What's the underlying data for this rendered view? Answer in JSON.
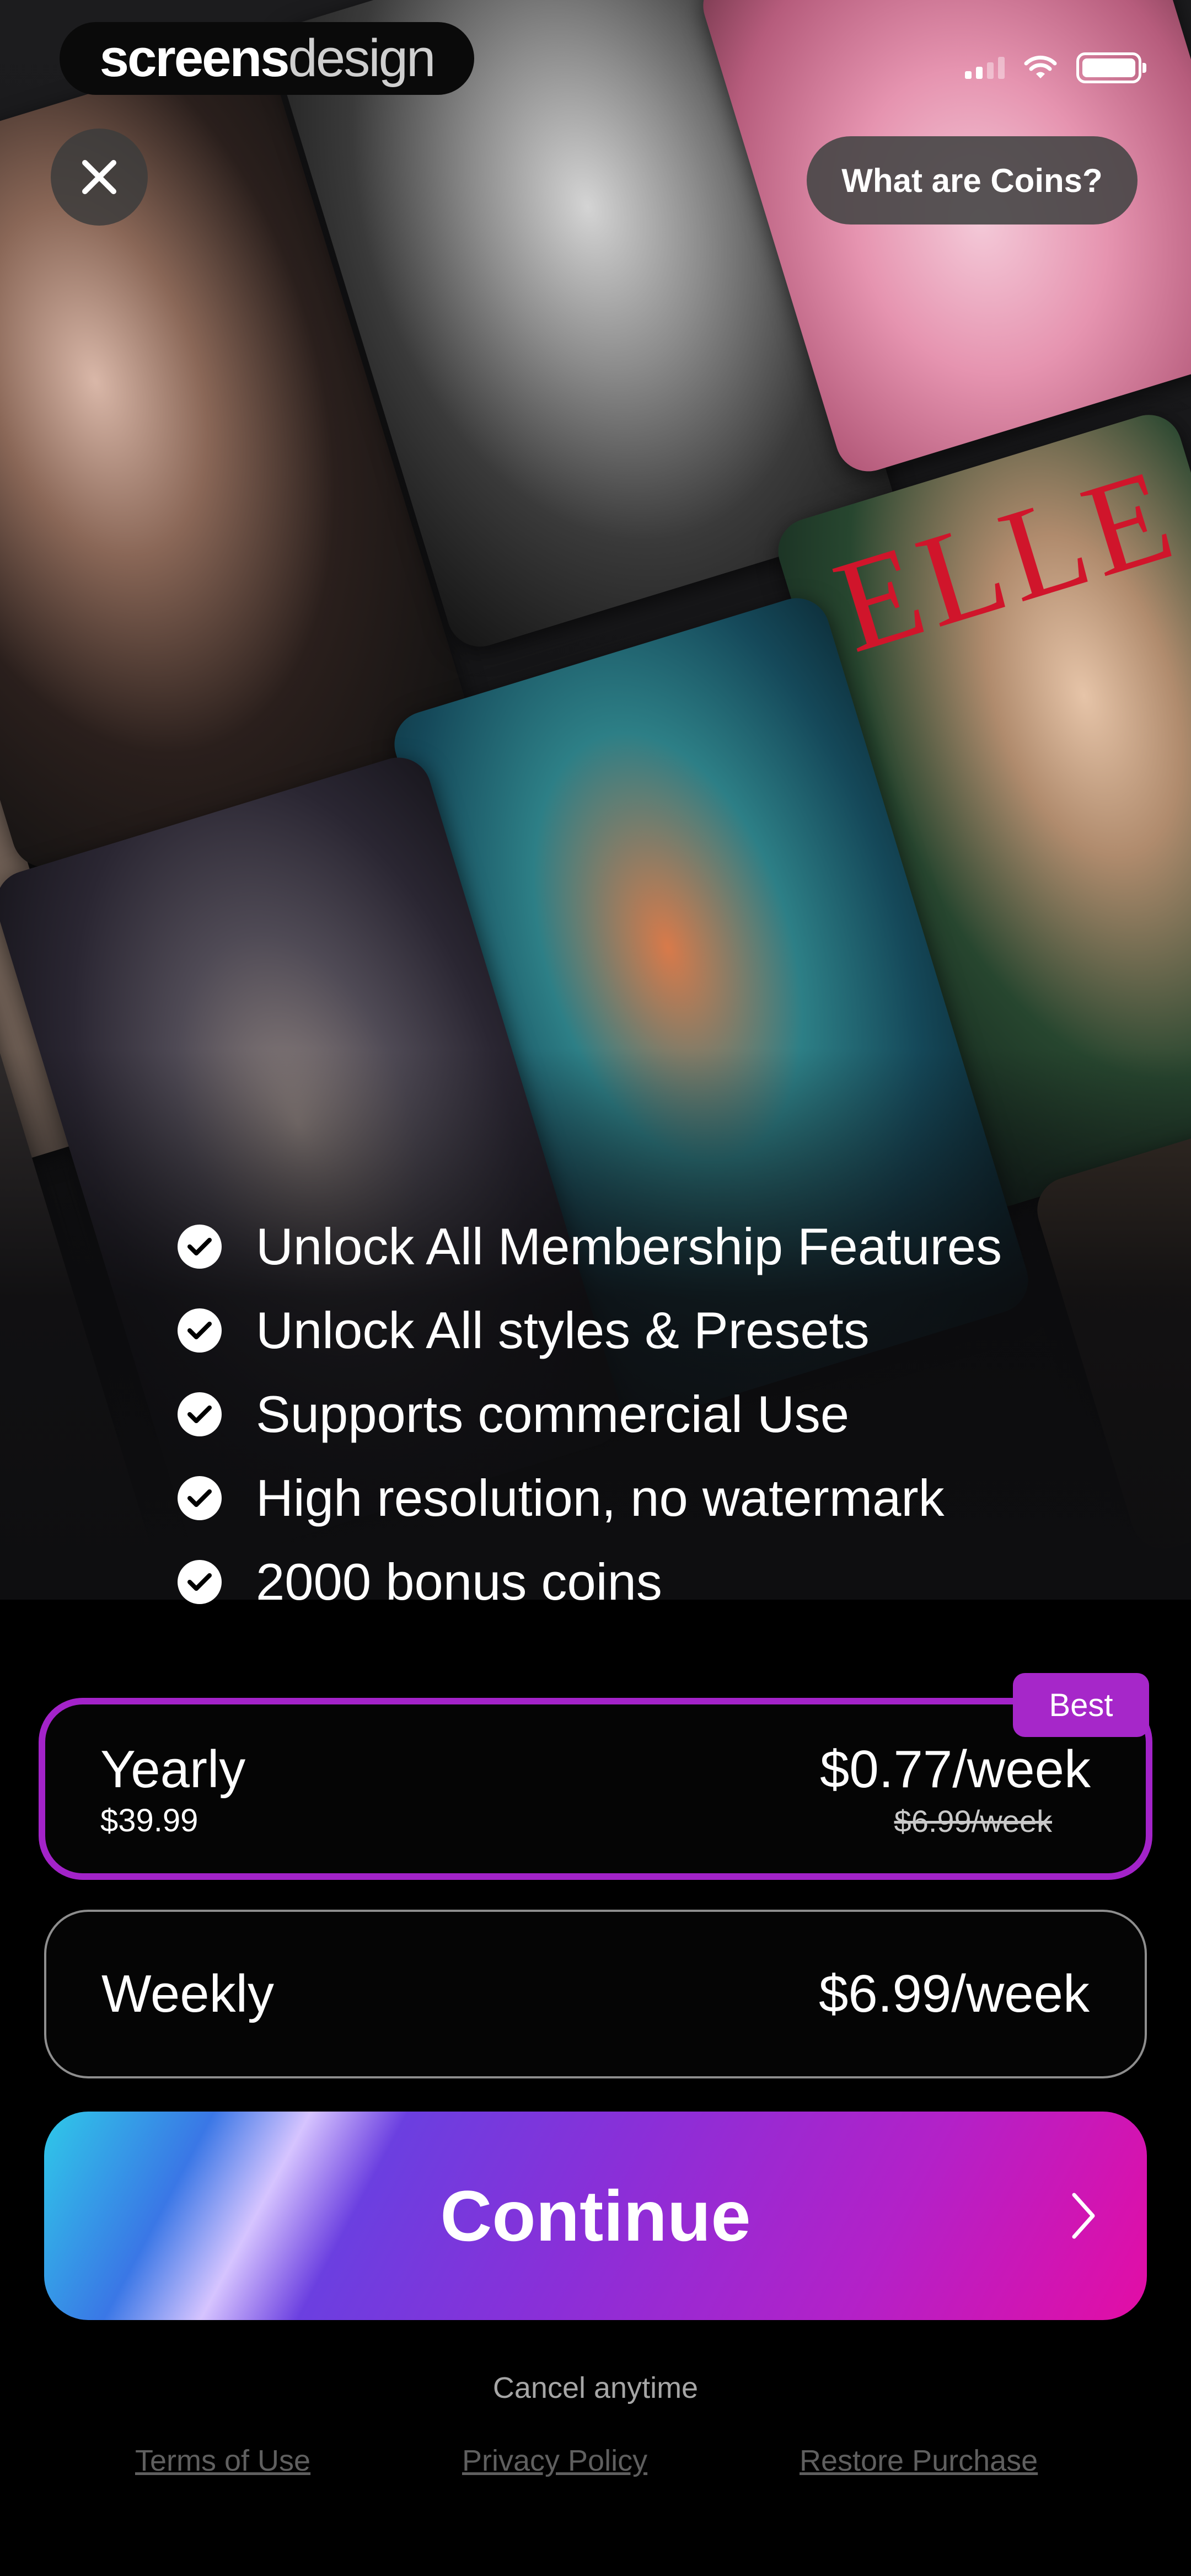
{
  "brand": {
    "logo_bold": "screens",
    "logo_light": "design"
  },
  "header": {
    "coins_button_label": "What are Coins?"
  },
  "features": [
    "Unlock All Membership Features",
    "Unlock All styles & Presets",
    "Supports commercial Use",
    "High resolution, no watermark",
    "2000 bonus coins"
  ],
  "hero": {
    "magazine_text": "ELLE"
  },
  "plans": {
    "yearly": {
      "name": "Yearly",
      "total": "$39.99",
      "price": "$0.77/week",
      "original_price": "$6.99/week",
      "badge": "Best",
      "selected": true
    },
    "weekly": {
      "name": "Weekly",
      "price": "$6.99/week",
      "selected": false
    }
  },
  "cta": {
    "continue_label": "Continue"
  },
  "cancel_text": "Cancel anytime",
  "footer": {
    "terms": "Terms of Use",
    "privacy": "Privacy Policy",
    "restore": "Restore Purchase"
  },
  "colors": {
    "accent_purple": "#a323c9",
    "gradient_start": "#2fc9e8",
    "gradient_end": "#e30da5",
    "background": "#000000"
  }
}
